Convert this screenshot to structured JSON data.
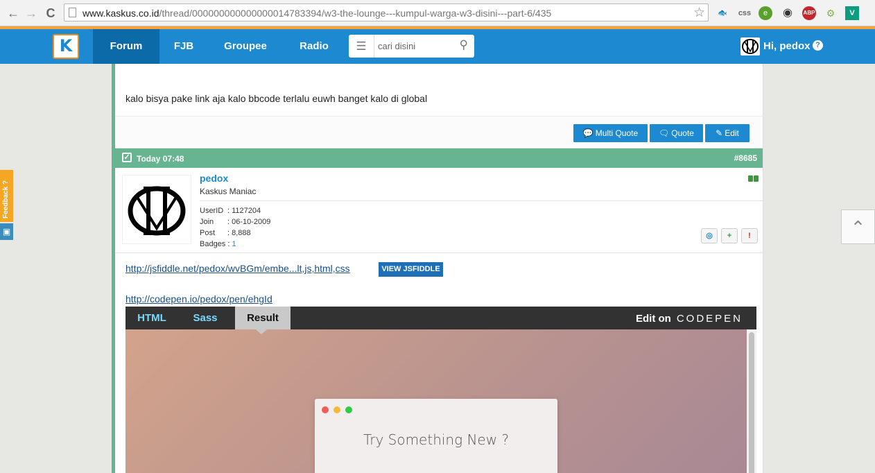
{
  "browser": {
    "url_host": "www.kaskus.co.id",
    "url_path": "/thread/000000000000000014783394/w3-the-lounge---kumpul-warga-w3-disini---part-6/435",
    "back_icon": "←",
    "forward_icon": "→",
    "reload_icon": "C",
    "star_icon": "☆",
    "extensions": [
      {
        "name": "fish-extension",
        "glyph": "🐟"
      },
      {
        "name": "css",
        "glyph": "css"
      },
      {
        "name": "evernote",
        "glyph": "e"
      },
      {
        "name": "circle-extension",
        "glyph": "◉"
      },
      {
        "name": "abp",
        "glyph": "ABP"
      },
      {
        "name": "android",
        "glyph": "⚙"
      },
      {
        "name": "vine",
        "glyph": "V"
      }
    ]
  },
  "topnav": {
    "logo": "K",
    "items": [
      {
        "label": "Forum",
        "active": true
      },
      {
        "label": "FJB",
        "active": false
      },
      {
        "label": "Groupee",
        "active": false
      },
      {
        "label": "Radio",
        "active": false
      }
    ],
    "search_placeholder": "cari disini",
    "user_greeting": "Hi, pedox",
    "help": "?"
  },
  "prev_post": {
    "text": "kalo bisya pake link aja kalo bbcode terlalu euwh banget kalo di global",
    "buttons": {
      "multi_quote": "Multi Quote",
      "quote": "Quote",
      "edit": "Edit"
    }
  },
  "post": {
    "time": "Today 07:48",
    "number": "#8685",
    "author": {
      "name": "pedox",
      "title": "Kaskus Maniac",
      "stats": [
        {
          "key": "UserID",
          "value": ": 1127204"
        },
        {
          "key": "Join",
          "value": ": 06-10-2009"
        },
        {
          "key": "Post",
          "value": ": 8,888"
        }
      ],
      "badges_label": "Badges :",
      "badges_value": "1"
    },
    "links": {
      "jsfiddle": "http://jsfiddle.net/pedox/wvBGm/embe...lt,js,html,css",
      "view_jsfiddle": "VIEW JSFIDDLE",
      "codepen": "http://codepen.io/pedox/pen/ehgId"
    },
    "codepen": {
      "tabs": [
        "HTML",
        "Sass",
        "Result"
      ],
      "active_tab": "Result",
      "edit_on": "Edit on",
      "brand": "CODEPEN",
      "demo_text": "Try Something New ?"
    }
  },
  "sidebar": {
    "feedback": "Feedback ?",
    "to_top_icon": "⌃"
  },
  "colors": {
    "nav_blue": "#1d89d0",
    "post_green": "#66b490",
    "feedback_orange": "#f5a623"
  }
}
